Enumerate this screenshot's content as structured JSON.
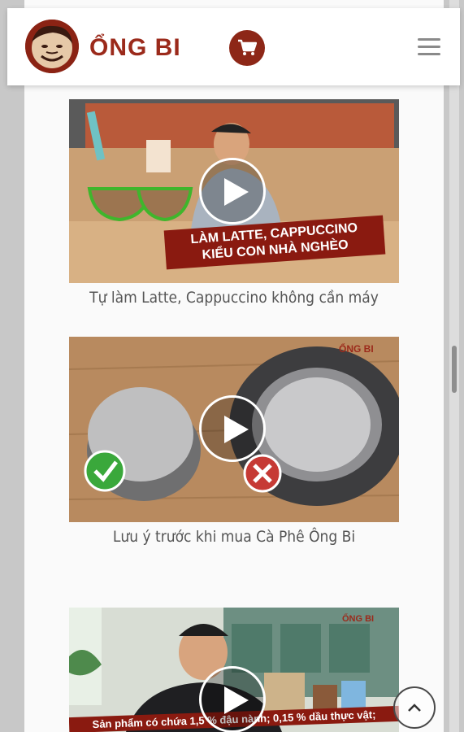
{
  "header": {
    "brand": "ỔNG BI",
    "background_text": "",
    "logo_icon": "founder-avatar-icon",
    "cart_icon": "cart-icon",
    "menu_icon": "hamburger-menu-icon"
  },
  "videos": [
    {
      "caption": "Tự làm Latte, Cappuccino không cần máy",
      "banner_line1": "LÀM LATTE, CAPPUCCINO",
      "banner_line2": "KIỂU CON NHÀ NGHÈO",
      "play_icon": "play-icon"
    },
    {
      "caption": "Lưu ý trước khi mua Cà Phê Ông Bi",
      "watermark": "ỔNG BI",
      "play_icon": "play-icon"
    },
    {
      "caption": "",
      "banner_text": "Sản phẩm có chứa 1,5 % đậu nành; 0,15 % dầu thực vật;",
      "watermark": "ỔNG BI",
      "play_icon": "play-icon"
    }
  ],
  "back_to_top_icon": "chevron-up-icon",
  "colors": {
    "brand": "#9b2a1b",
    "cart": "#8d2717",
    "caption": "#555555"
  }
}
